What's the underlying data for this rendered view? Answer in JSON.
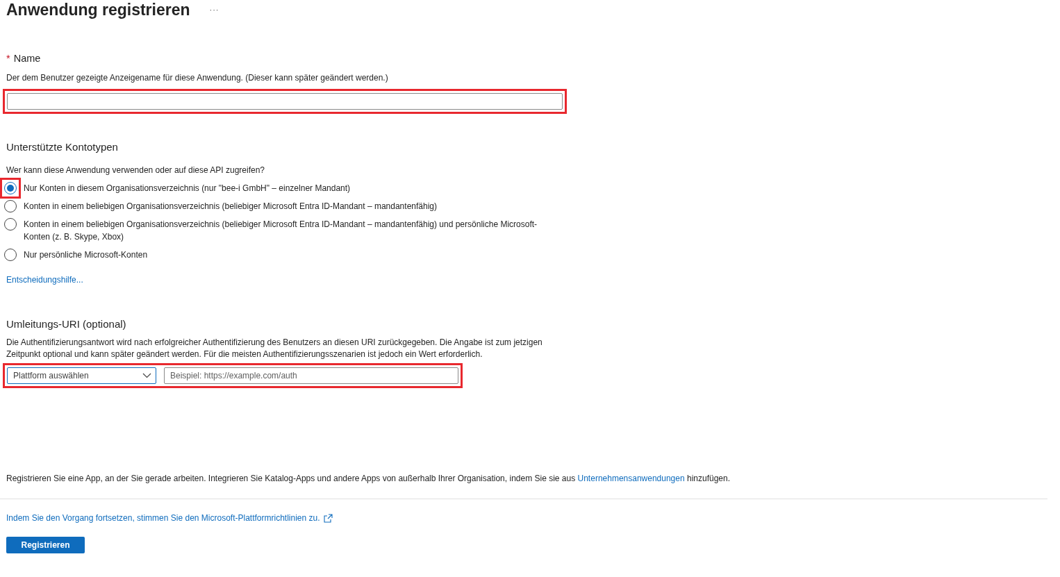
{
  "header": {
    "title": "Anwendung registrieren",
    "more": "···"
  },
  "name_section": {
    "required_mark": "*",
    "label": "Name",
    "description": "Der dem Benutzer gezeigte Anzeigename für diese Anwendung. (Dieser kann später geändert werden.)",
    "highlighted": true
  },
  "account_types": {
    "heading": "Unterstützte Kontotypen",
    "question": "Wer kann diese Anwendung verwenden oder auf diese API zugreifen?",
    "options": [
      {
        "label": "Nur Konten in diesem Organisationsverzeichnis (nur \"bee-i GmbH\" – einzelner Mandant)",
        "selected": true,
        "highlighted": true
      },
      {
        "label": "Konten in einem beliebigen Organisationsverzeichnis (beliebiger Microsoft Entra ID-Mandant – mandantenfähig)",
        "selected": false,
        "highlighted": false
      },
      {
        "label": "Konten in einem beliebigen Organisationsverzeichnis (beliebiger Microsoft Entra ID-Mandant – mandantenfähig) und persönliche Microsoft-Konten (z. B. Skype, Xbox)",
        "selected": false,
        "highlighted": false
      },
      {
        "label": "Nur persönliche Microsoft-Konten",
        "selected": false,
        "highlighted": false
      }
    ],
    "help_link": "Entscheidungshilfe..."
  },
  "redirect": {
    "heading": "Umleitungs-URI (optional)",
    "description": "Die Authentifizierungsantwort wird nach erfolgreicher Authentifizierung des Benutzers an diesen URI zurückgegeben. Die Angabe ist zum jetzigen Zeitpunkt optional und kann später geändert werden. Für die meisten Authentifizierungsszenarien ist jedoch ein Wert erforderlich.",
    "platform": "Plattform auswählen",
    "uri_placeholder": "Beispiel: https://example.com/auth",
    "highlighted": true
  },
  "footer": {
    "note_before": "Registrieren Sie eine App, an der Sie gerade arbeiten. Integrieren Sie Katalog-Apps und andere Apps von außerhalb Ihrer Organisation, indem Sie sie aus",
    "note_link": "Unternehmensanwendungen",
    "note_after": "hinzufügen.",
    "policy_link": "Indem Sie den Vorgang fortsetzen, stimmen Sie den Microsoft-Plattformrichtlinien zu.",
    "button": "Registrieren"
  }
}
